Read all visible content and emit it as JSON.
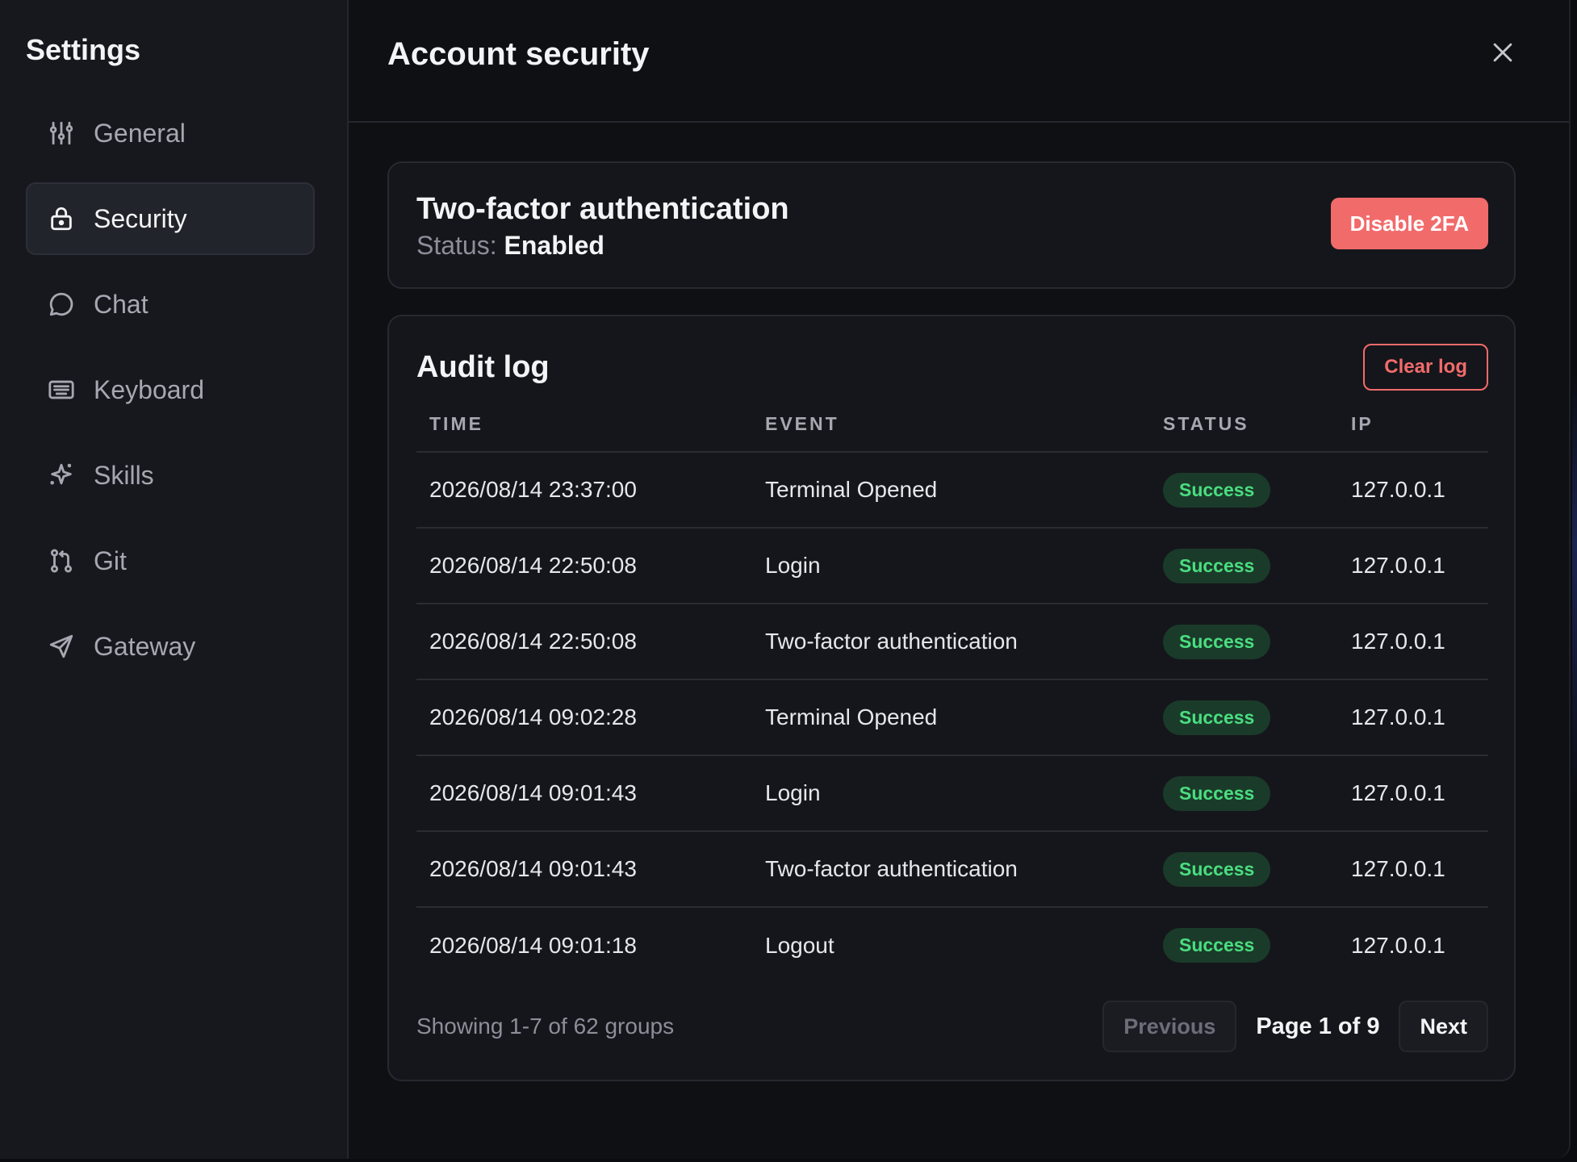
{
  "sidebar": {
    "title": "Settings",
    "items": [
      {
        "label": "General",
        "icon": "sliders-icon"
      },
      {
        "label": "Security",
        "icon": "lock-icon"
      },
      {
        "label": "Chat",
        "icon": "chat-bubble-icon"
      },
      {
        "label": "Keyboard",
        "icon": "keyboard-icon"
      },
      {
        "label": "Skills",
        "icon": "sparkle-icon"
      },
      {
        "label": "Git",
        "icon": "git-pull-request-icon"
      },
      {
        "label": "Gateway",
        "icon": "send-icon"
      }
    ],
    "active": "Security"
  },
  "header": {
    "title": "Account security",
    "close_icon": "close-icon"
  },
  "twofa": {
    "title": "Two-factor authentication",
    "status_label": "Status:",
    "status_value": "Enabled",
    "disable_button": "Disable 2FA"
  },
  "audit": {
    "title": "Audit log",
    "clear_button": "Clear log",
    "columns": [
      "TIME",
      "EVENT",
      "STATUS",
      "IP"
    ],
    "rows": [
      {
        "time": "2026/08/14 23:37:00",
        "event": "Terminal Opened",
        "status": "Success",
        "ip": "127.0.0.1"
      },
      {
        "time": "2026/08/14 22:50:08",
        "event": "Login",
        "status": "Success",
        "ip": "127.0.0.1"
      },
      {
        "time": "2026/08/14 22:50:08",
        "event": "Two-factor authentication",
        "status": "Success",
        "ip": "127.0.0.1"
      },
      {
        "time": "2026/08/14 09:02:28",
        "event": "Terminal Opened",
        "status": "Success",
        "ip": "127.0.0.1"
      },
      {
        "time": "2026/08/14 09:01:43",
        "event": "Login",
        "status": "Success",
        "ip": "127.0.0.1"
      },
      {
        "time": "2026/08/14 09:01:43",
        "event": "Two-factor authentication",
        "status": "Success",
        "ip": "127.0.0.1"
      },
      {
        "time": "2026/08/14 09:01:18",
        "event": "Logout",
        "status": "Success",
        "ip": "127.0.0.1"
      }
    ],
    "showing": "Showing 1-7 of 62 groups",
    "prev_label": "Previous",
    "page_label": "Page 1 of 9",
    "next_label": "Next"
  },
  "colors": {
    "accent_danger": "#f26b6b",
    "success": "#4ade80",
    "background": "#0f1014",
    "sidebar": "#17181e"
  }
}
